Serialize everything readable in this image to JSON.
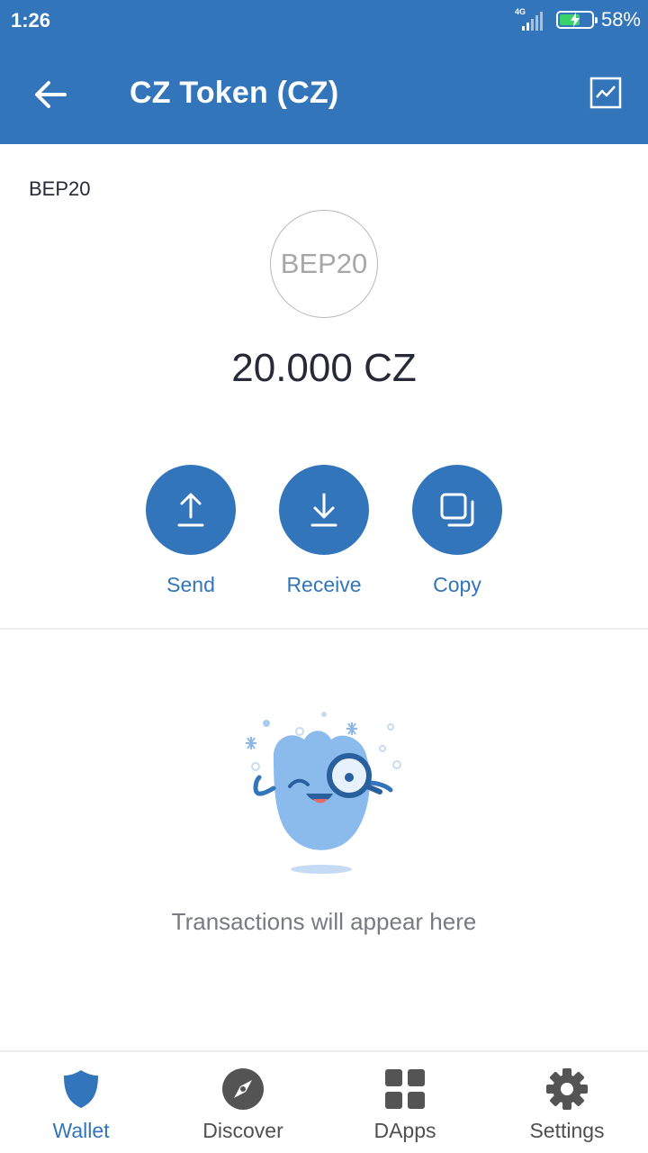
{
  "status_bar": {
    "time": "1:26",
    "network": "4G",
    "battery": "58%"
  },
  "app_bar": {
    "title": "CZ Token (CZ)",
    "back_icon": "arrow-left-icon",
    "chart_icon": "price-chart-icon"
  },
  "token": {
    "network_label": "BEP20",
    "logo_text": "BEP20",
    "balance": "20.000 CZ"
  },
  "actions": [
    {
      "label": "Send",
      "icon": "upload-icon"
    },
    {
      "label": "Receive",
      "icon": "download-icon"
    },
    {
      "label": "Copy",
      "icon": "copy-icon"
    }
  ],
  "transactions": {
    "empty_message": "Transactions will appear here"
  },
  "bottom_nav": [
    {
      "label": "Wallet",
      "icon": "shield-icon",
      "active": true
    },
    {
      "label": "Discover",
      "icon": "compass-icon",
      "active": false
    },
    {
      "label": "DApps",
      "icon": "grid-icon",
      "active": false
    },
    {
      "label": "Settings",
      "icon": "gear-icon",
      "active": false
    }
  ],
  "colors": {
    "primary": "#3375bb",
    "text": "#262a38",
    "muted": "#777a80",
    "battery_charge": "#3ad26b"
  }
}
